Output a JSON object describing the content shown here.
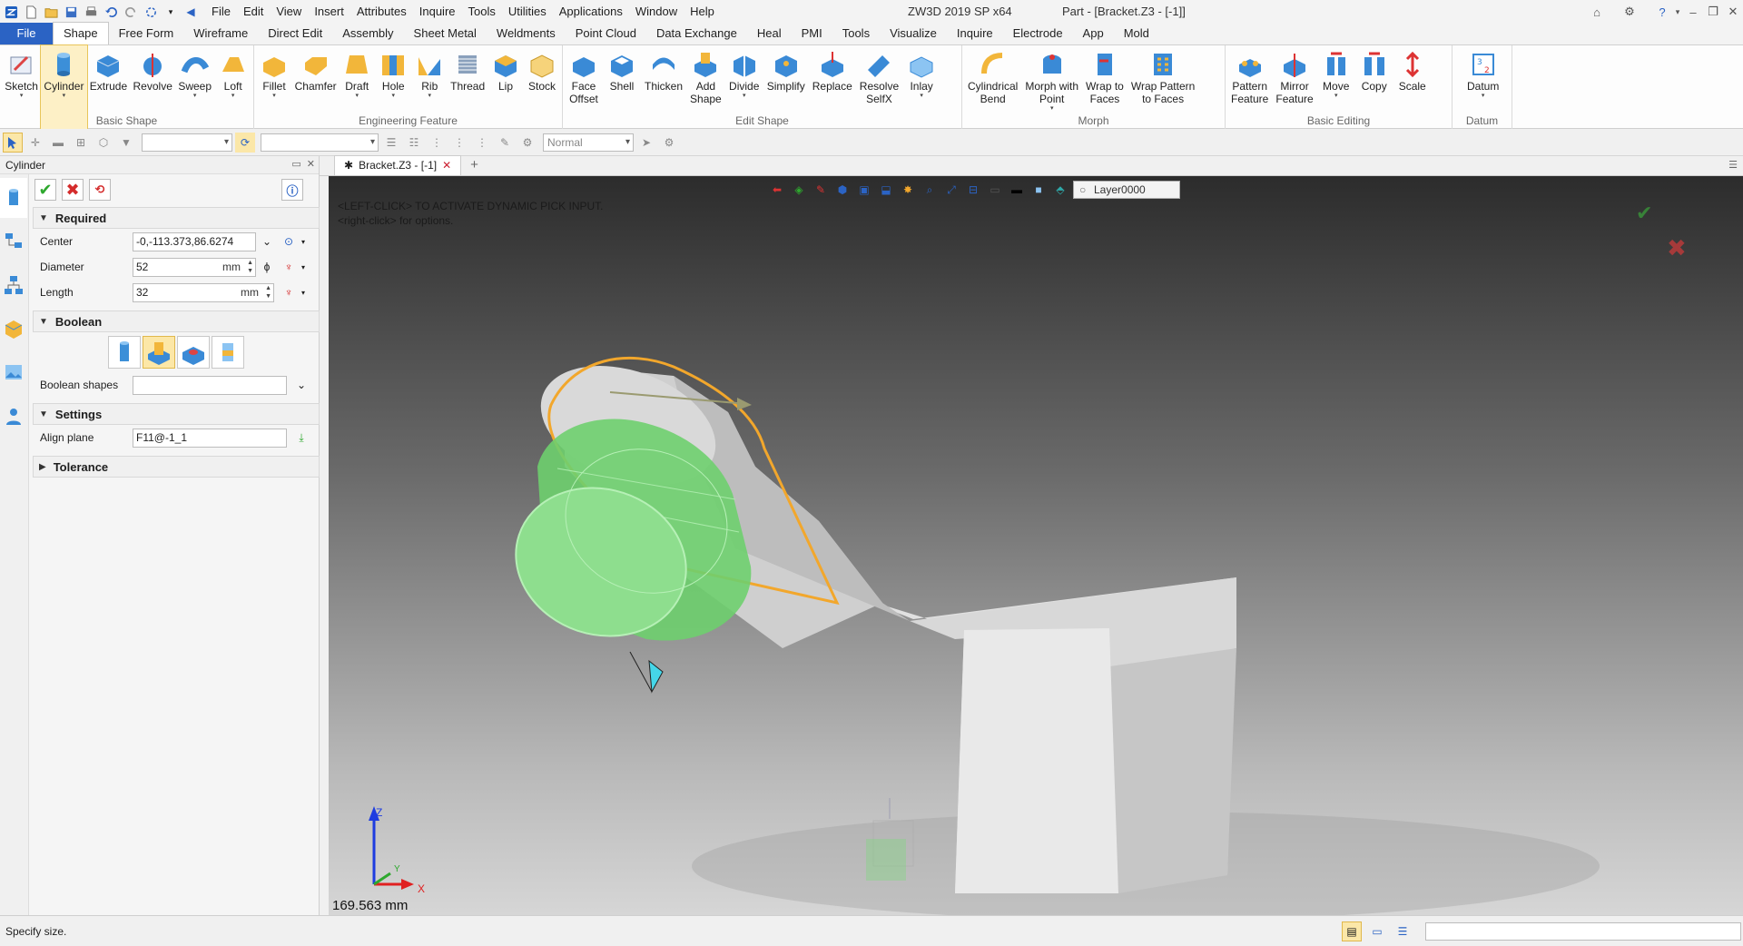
{
  "titlebar": {
    "menu": [
      "File",
      "Edit",
      "View",
      "Insert",
      "Attributes",
      "Inquire",
      "Tools",
      "Utilities",
      "Applications",
      "Window",
      "Help"
    ],
    "app_title": "ZW3D 2019 SP x64",
    "doc_title": "Part - [Bracket.Z3 - [-1]]"
  },
  "ribbon_tabs": [
    "File",
    "Shape",
    "Free Form",
    "Wireframe",
    "Direct Edit",
    "Assembly",
    "Sheet Metal",
    "Weldments",
    "Point Cloud",
    "Data Exchange",
    "Heal",
    "PMI",
    "Tools",
    "Visualize",
    "Inquire",
    "Electrode",
    "App",
    "Mold"
  ],
  "ribbon": {
    "basic_shape": {
      "label": "Basic Shape",
      "items": [
        "Sketch",
        "Cylinder",
        "Extrude",
        "Revolve",
        "Sweep",
        "Loft"
      ]
    },
    "engineering": {
      "label": "Engineering Feature",
      "items": [
        "Fillet",
        "Chamfer",
        "Draft",
        "Hole",
        "Rib",
        "Thread",
        "Lip",
        "Stock"
      ]
    },
    "edit_shape": {
      "label": "Edit Shape",
      "items": [
        "Face\nOffset",
        "Shell",
        "Thicken",
        "Add\nShape",
        "Divide",
        "Simplify",
        "Replace",
        "Resolve\nSelfX",
        "Inlay"
      ]
    },
    "morph": {
      "label": "Morph",
      "items": [
        "Cylindrical\nBend",
        "Morph with\nPoint",
        "Wrap to\nFaces",
        "Wrap Pattern\nto Faces"
      ]
    },
    "basic_editing": {
      "label": "Basic Editing",
      "items": [
        "Pattern\nFeature",
        "Mirror\nFeature",
        "Move",
        "Copy",
        "Scale"
      ]
    },
    "datum": {
      "label": "Datum",
      "items": [
        "Datum"
      ]
    }
  },
  "toolbar2": {
    "render_mode": "Normal"
  },
  "panel": {
    "title": "Cylinder",
    "required": {
      "label": "Required",
      "center_label": "Center",
      "center_value": "-0,-113.373,86.6274",
      "diameter_label": "Diameter",
      "diameter_value": "52",
      "diameter_unit": "mm",
      "length_label": "Length",
      "length_value": "32",
      "length_unit": "mm"
    },
    "boolean": {
      "label": "Boolean",
      "shapes_label": "Boolean shapes",
      "shapes_value": ""
    },
    "settings": {
      "label": "Settings",
      "align_label": "Align plane",
      "align_value": "F11@-1_1"
    },
    "tolerance": {
      "label": "Tolerance"
    }
  },
  "doc_tab": {
    "label": "Bracket.Z3 - [-1]"
  },
  "viewport": {
    "hint1": "<LEFT-CLICK> TO ACTIVATE DYNAMIC PICK INPUT.",
    "hint2": "<right-click> for options.",
    "layer": "Layer0000",
    "measure": "169.563 mm",
    "axis_x": "X",
    "axis_y": "Y",
    "axis_z": "Z"
  },
  "status": {
    "text": "Specify size."
  },
  "colors": {
    "accent": "#2b63c4",
    "preview_green": "#7fd67f",
    "highlight_orange": "#f2a72c",
    "ok_green": "#2ea82e",
    "cancel_red": "#d42b2b"
  }
}
